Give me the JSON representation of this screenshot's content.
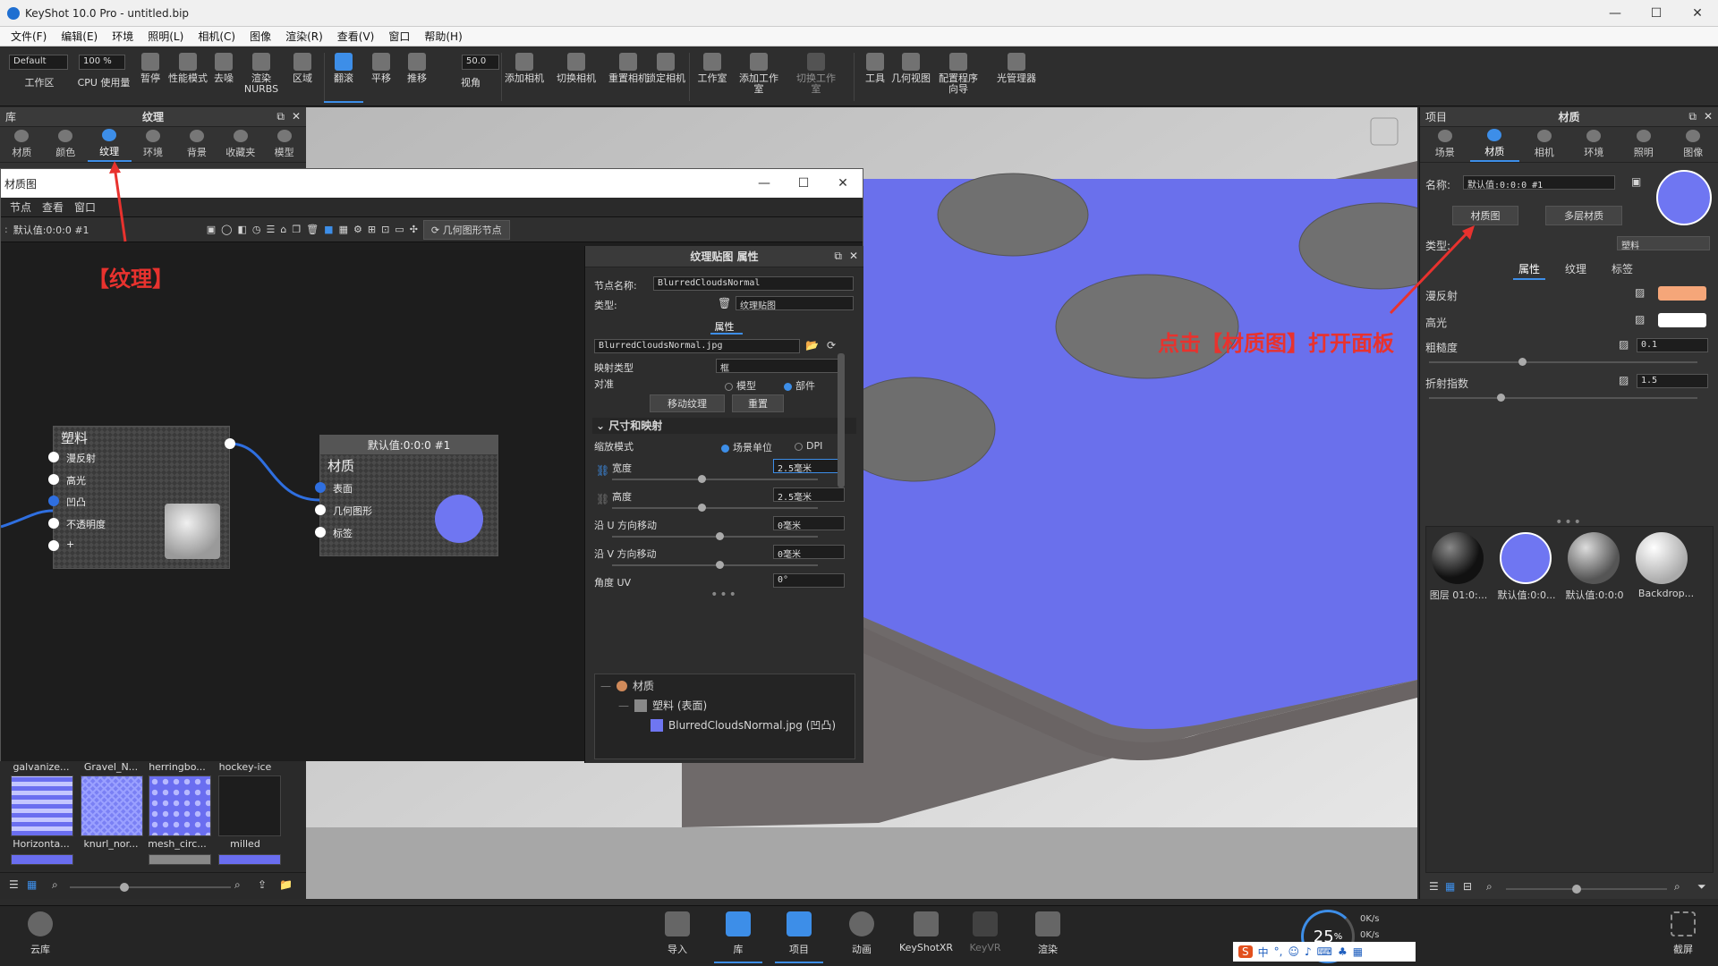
{
  "window": {
    "title": "KeyShot 10.0 Pro  -  untitled.bip"
  },
  "menu": [
    "文件(F)",
    "编辑(E)",
    "环境",
    "照明(L)",
    "相机(C)",
    "图像",
    "渲染(R)",
    "查看(V)",
    "窗口",
    "帮助(H)"
  ],
  "ribbon": {
    "preset": "Default",
    "zoom": "100 %",
    "fov": "50.0",
    "buttons": [
      "工作区",
      "CPU 使用量",
      "暂停",
      "性能模式",
      "去噪",
      "渲染NURBS",
      "区域",
      "翻滚",
      "平移",
      "推移",
      "视角",
      "添加相机",
      "切换相机",
      "重置相机",
      "锁定相机",
      "工作室",
      "添加工作室",
      "切换工作室",
      "工具",
      "几何视图",
      "配置程序向导",
      "光管理器"
    ]
  },
  "library": {
    "header_left": "库",
    "title": "纹理",
    "tabs": [
      "材质",
      "颜色",
      "纹理",
      "环境",
      "背景",
      "收藏夹",
      "模型"
    ],
    "thumbs": {
      "top_labels": [
        "galvanize...",
        "Gravel_N...",
        "herringbo...",
        "hockey-ice"
      ],
      "labels": [
        "Horizonta...",
        "knurl_nor...",
        "mesh_circ...",
        "milled"
      ]
    }
  },
  "material_graph": {
    "title": "材质图",
    "menu": [
      "节点",
      "查看",
      "窗口"
    ],
    "name_field": "默认值:0:0:0 #1",
    "geom_node_button": "几何图形节点",
    "plastic_node": {
      "title": "塑料",
      "ports": [
        "漫反射",
        "高光",
        "凹凸",
        "不透明度",
        "+"
      ]
    },
    "material_node": {
      "header": "默认值:0:0:0 #1",
      "title": "材质",
      "ports": [
        "表面",
        "几何图形",
        "标签"
      ]
    }
  },
  "texture_props": {
    "title": "纹理贴图 属性",
    "node_name_label": "节点名称:",
    "node_name": "BlurredCloudsNormal",
    "type_label": "类型:",
    "type_value": "纹理贴图",
    "section_tab": "属性",
    "file": "BlurredCloudsNormal.jpg",
    "mapping_type_label": "映射类型",
    "mapping_type": "框",
    "align_label": "对准",
    "align_opts": [
      "模型",
      "部件"
    ],
    "move_texture": "移动纹理",
    "reset": "重置",
    "size_section": "尺寸和映射",
    "scale_mode_label": "缩放模式",
    "scale_opts": [
      "场景单位",
      "DPI"
    ],
    "width_label": "宽度",
    "width": "2.5毫米",
    "height_label": "高度",
    "height": "2.5毫米",
    "u_move_label": "沿 U 方向移动",
    "u_move": "0毫米",
    "v_move_label": "沿 V 方向移动",
    "v_move": "0毫米",
    "angle_label": "角度 UV",
    "angle": "0°",
    "tree": {
      "root": "材质",
      "child": "塑料 (表面)",
      "leaf": "BlurredCloudsNormal.jpg (凹凸)"
    }
  },
  "project_panel": {
    "header_left": "项目",
    "title": "材质",
    "tabs": [
      "场景",
      "材质",
      "相机",
      "环境",
      "照明",
      "图像"
    ],
    "name_label": "名称:",
    "name_value": "默认值:0:0:0 #1",
    "btn_graph": "材质图",
    "btn_multi": "多层材质",
    "type_label": "类型:",
    "type_value": "塑料",
    "subtabs": [
      "属性",
      "纹理",
      "标签"
    ],
    "props": [
      {
        "label": "漫反射",
        "value": ""
      },
      {
        "label": "高光",
        "value": ""
      },
      {
        "label": "粗糙度",
        "value": "0.1"
      },
      {
        "label": "折射指数",
        "value": "1.5"
      }
    ],
    "swatches": [
      "图层 01:0:...",
      "默认值:0:0...",
      "默认值:0:0:0",
      "Backdrop..."
    ],
    "colors": {
      "diffuse": "#f5a679",
      "specular": "#ffffff",
      "material_ball": "#6f76f2"
    }
  },
  "annotations": {
    "texture": "【纹理】",
    "open_panel": "点击【材质图】打开面板"
  },
  "bottom": {
    "cloud": "云库",
    "buttons": [
      "导入",
      "库",
      "项目",
      "动画",
      "KeyShotXR",
      "KeyVR",
      "渲染"
    ],
    "screenshot": "截屏",
    "gauge": "25",
    "gauge_unit": "%",
    "net_up": "0K/s",
    "net_down": "0K/s"
  }
}
